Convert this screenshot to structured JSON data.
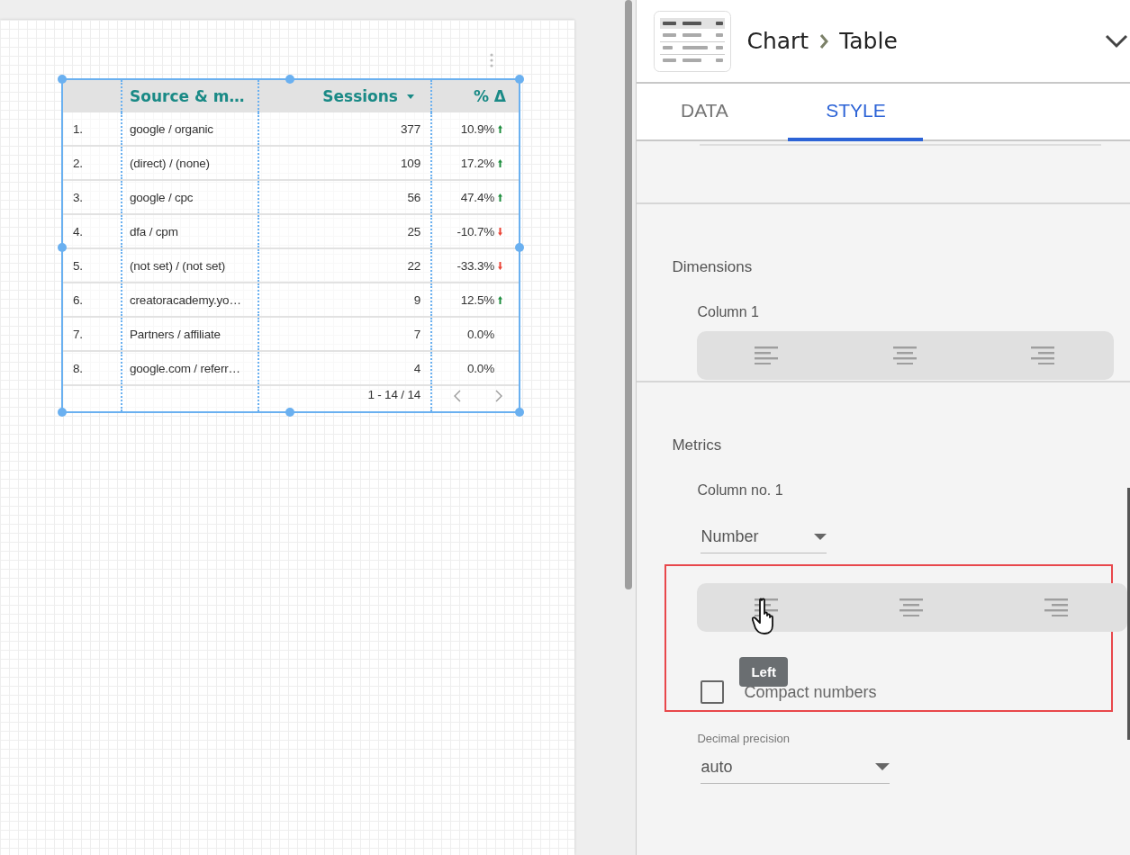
{
  "header": {
    "breadcrumb": [
      "Chart",
      "Table"
    ]
  },
  "tabs": [
    {
      "label": "DATA",
      "selected": false
    },
    {
      "label": "STYLE",
      "selected": true
    }
  ],
  "table": {
    "columns": [
      {
        "label": "Source & m…",
        "sorted": false
      },
      {
        "label": "Sessions",
        "sorted": true
      },
      {
        "label": "% Δ",
        "sorted": false
      }
    ],
    "rows": [
      {
        "index": "1.",
        "source": "google / organic",
        "sessions": "377",
        "change": "10.9%",
        "kind": "up"
      },
      {
        "index": "2.",
        "source": "(direct) / (none)",
        "sessions": "109",
        "change": "17.2%",
        "kind": "up"
      },
      {
        "index": "3.",
        "source": "google / cpc",
        "sessions": "56",
        "change": "47.4%",
        "kind": "up"
      },
      {
        "index": "4.",
        "source": "dfa / cpm",
        "sessions": "25",
        "change": "-10.7%",
        "kind": "down"
      },
      {
        "index": "5.",
        "source": "(not set) / (not set)",
        "sessions": "22",
        "change": "-33.3%",
        "kind": "down"
      },
      {
        "index": "6.",
        "source": "creatoracademy.yo…",
        "sessions": "9",
        "change": "12.5%",
        "kind": "up"
      },
      {
        "index": "7.",
        "source": "Partners / affiliate",
        "sessions": "7",
        "change": "0.0%",
        "kind": "flat"
      },
      {
        "index": "8.",
        "source": "google.com / referr…",
        "sessions": "4",
        "change": "0.0%",
        "kind": "flat"
      }
    ],
    "pagination": "1 - 14 / 14"
  },
  "dimensions": {
    "title": "Dimensions",
    "column_label": "Column 1"
  },
  "metrics": {
    "title": "Metrics",
    "column_label": "Column no. 1",
    "type": "Number",
    "tooltip": "Left",
    "compact_numbers": {
      "label": "Compact numbers",
      "checked": false
    },
    "decimal_precision": {
      "label": "Decimal precision",
      "value": "auto"
    }
  }
}
